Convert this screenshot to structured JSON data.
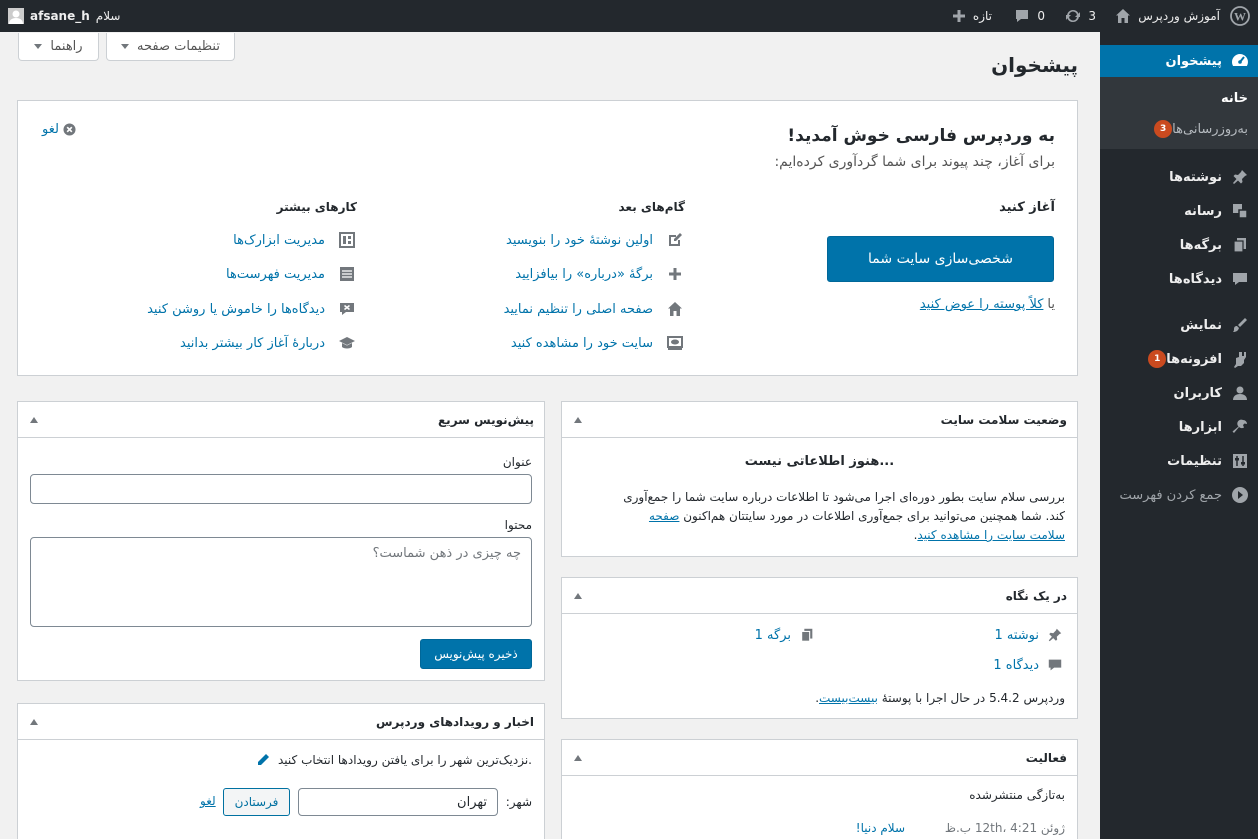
{
  "adminbar": {
    "site_name": "آموزش وردپرس",
    "updates_count": "3",
    "comments_count": "0",
    "new_label": "تازه",
    "greeting": "سلام",
    "username": "afsane_h"
  },
  "screen_options": {
    "screen_settings_label": "تنظیمات صفحه",
    "help_label": "راهنما"
  },
  "page_title": "پیشخوان",
  "sidebar": {
    "dashboard": "پیشخوان",
    "submenu_home": "خانه",
    "submenu_updates": "به‌روزرسانی‌ها",
    "updates_badge": "3",
    "posts": "نوشته‌ها",
    "media": "رسانه",
    "pages": "برگه‌ها",
    "comments": "دیدگاه‌ها",
    "appearance": "نمایش",
    "plugins": "افزونه‌ها",
    "plugins_badge": "1",
    "users": "کاربران",
    "tools": "ابزارها",
    "settings": "تنظیمات",
    "collapse": "جمع کردن فهرست"
  },
  "welcome": {
    "title": "به وردپرس فارسی خوش آمدید!",
    "subtitle": "برای آغاز، چند پیوند برای شما گردآوری کرده‌ایم:",
    "dismiss": "لغو",
    "get_started": "آغاز کنید",
    "customize_button": "شخصی‌سازی سایت شما",
    "or_text": "یا",
    "change_theme_link": "کلاً پوسته را عوض کنید",
    "next_steps_title": "گام‌های بعد",
    "next_steps": [
      {
        "label": "اولین نوشتهٔ خود را بنویسید",
        "icon": "edit-icon"
      },
      {
        "label": "برگهٔ «درباره» را بیافزایید",
        "icon": "plus-icon"
      },
      {
        "label": "صفحه اصلی را تنظیم نمایید",
        "icon": "home-icon"
      },
      {
        "label": "سایت خود را مشاهده کنید",
        "icon": "view-site-icon"
      }
    ],
    "more_actions_title": "کارهای بیشتر",
    "more_actions": [
      {
        "label": "مدیریت ابزارک‌ها",
        "icon": "widgets-icon"
      },
      {
        "label": "مدیریت فهرست‌ها",
        "icon": "menus-icon"
      },
      {
        "label": "دیدگاه‌ها را خاموش یا روشن کنید",
        "icon": "comments-off-icon"
      },
      {
        "label": "دربارهٔ آغاز کار بیشتر بدانید",
        "icon": "learn-more-icon"
      }
    ]
  },
  "site_health": {
    "title": "وضعیت سلامت سایت",
    "heading": "هنوز اطلاعاتی نیست...",
    "line1": "بررسی سلام سایت بطور دوره‌ای اجرا می‌شود تا اطلاعات درباره سایت شما را جمع‌آوری",
    "line2_prefix": "کند. شما همچنین می‌توانید برای جمع‌آوری اطلاعات در مورد سایتتان هم‌اکنون ",
    "line2_link": "صفحه",
    "line3_link": "سلامت سایت را مشاهده کنید",
    "line3_suffix": "."
  },
  "at_a_glance": {
    "title": "در یک نگاه",
    "posts": "1 نوشته",
    "pages": "1 برگه",
    "comments": "1 دیدگاه",
    "version_prefix": "وردپرس 5.4.2 در حال اجرا با پوستهٔ ",
    "theme_link": "بیست‌بیست",
    "version_suffix": "."
  },
  "activity": {
    "title": "فعالیت",
    "recently_published": "به‌تازگی منتشرشده",
    "item_date": "ژوئن 12th، 4:21 ب.ظ",
    "item_title": "سلام دنیا!"
  },
  "quick_draft": {
    "title": "پیش‌نویس سریع",
    "title_label": "عنوان",
    "title_value": "",
    "content_label": "محتوا",
    "content_placeholder": "چه چیزی در ذهن شماست؟",
    "save_button": "ذخیره پیش‌نویس"
  },
  "events": {
    "title": "اخبار و رویدادهای وردپرس",
    "prompt": "نزدیک‌ترین شهر را برای یافتن رویدادها انتخاب کنید.",
    "city_label": "شهر:",
    "city_value": "تهران",
    "submit_button": "فرستادن",
    "cancel": "لغو"
  },
  "colors": {
    "accent": "#0073aa",
    "adminbar_bg": "#23282d",
    "badge": "#ca4a1f"
  }
}
